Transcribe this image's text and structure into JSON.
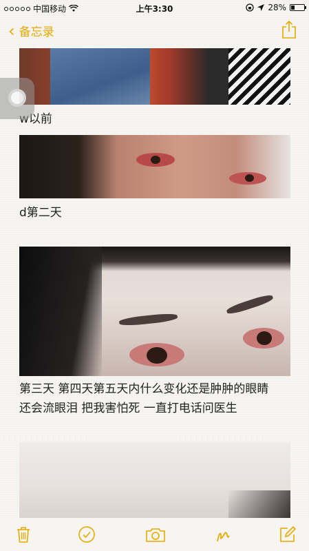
{
  "status_bar": {
    "carrier": "中国移动",
    "time": "上午3:30",
    "battery": "28%",
    "battery_level": 0.28
  },
  "nav": {
    "back_label": "备忘录"
  },
  "notes": [
    {
      "caption": "w以前"
    },
    {
      "caption": "d第二天"
    },
    {
      "caption_line1": "第三天 第四天第五天内什么变化还是肿肿的眼睛",
      "caption_line2": "还会流眼泪 把我害怕死 一直打电话问医生"
    }
  ],
  "toolbar": {
    "icons": [
      "trash-icon",
      "checkmark-icon",
      "camera-icon",
      "sketch-icon",
      "compose-icon"
    ]
  },
  "accent_color": "#e5a900"
}
